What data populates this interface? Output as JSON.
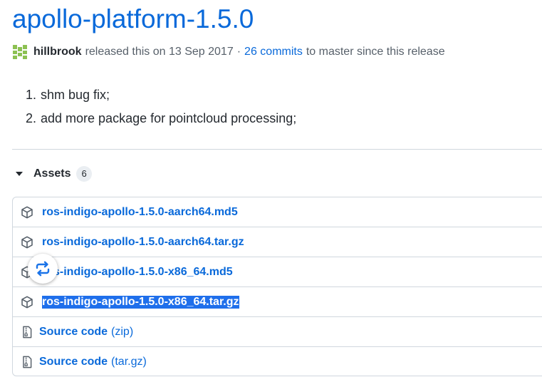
{
  "release": {
    "title": "apollo-platform-1.5.0",
    "author": "hillbrook",
    "released_text": "released this on 13 Sep 2017",
    "separator": "·",
    "commits_link": "26 commits",
    "commits_suffix": "to master since this release"
  },
  "notes": [
    {
      "num": "1.",
      "text": "shm bug fix;"
    },
    {
      "num": "2.",
      "text": "add more package for pointcloud processing;"
    }
  ],
  "assets": {
    "label": "Assets",
    "count": "6",
    "items": [
      {
        "name": "ros-indigo-apollo-1.5.0-aarch64.md5",
        "icon": "package-icon"
      },
      {
        "name": "ros-indigo-apollo-1.5.0-aarch64.tar.gz",
        "icon": "package-icon"
      },
      {
        "name": "ros-indigo-apollo-1.5.0-x86_64.md5",
        "icon": "package-icon"
      },
      {
        "name": "ros-indigo-apollo-1.5.0-x86_64.tar.gz",
        "icon": "package-icon",
        "selected": true
      },
      {
        "name": "Source code",
        "ext": "(zip)",
        "icon": "file-zip-icon"
      },
      {
        "name": "Source code",
        "ext": "(tar.gz)",
        "icon": "file-zip-icon"
      }
    ]
  },
  "colors": {
    "link": "#0969da",
    "selection": "#1f6feb",
    "border": "#d0d7de",
    "avatar": "#8cc152"
  },
  "floating_button": {
    "icon": "repeat-arrows-icon"
  }
}
